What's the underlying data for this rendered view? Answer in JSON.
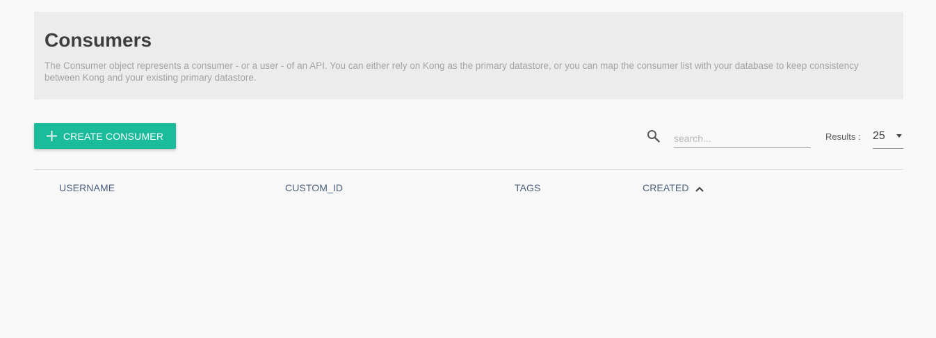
{
  "header": {
    "title": "Consumers",
    "description": "The Consumer object represents a consumer - or a user - of an API. You can either rely on Kong as the primary datastore, or you can map the consumer list with your database to keep consistency between Kong and your existing primary datastore."
  },
  "toolbar": {
    "create_label": "CREATE CONSUMER",
    "create_icon": "plus-icon",
    "search_icon": "search-icon",
    "search_placeholder": "search...",
    "search_value": "",
    "results_label": "Results :",
    "results_value": "25"
  },
  "table": {
    "columns": [
      {
        "label": "USERNAME"
      },
      {
        "label": "CUSTOM_ID"
      },
      {
        "label": "TAGS"
      },
      {
        "label": "CREATED",
        "sort": "ascending"
      }
    ],
    "rows": []
  },
  "colors": {
    "accent": "#1abc9c",
    "header_text": "#4a5e7c",
    "panel_bg": "#ececec"
  }
}
